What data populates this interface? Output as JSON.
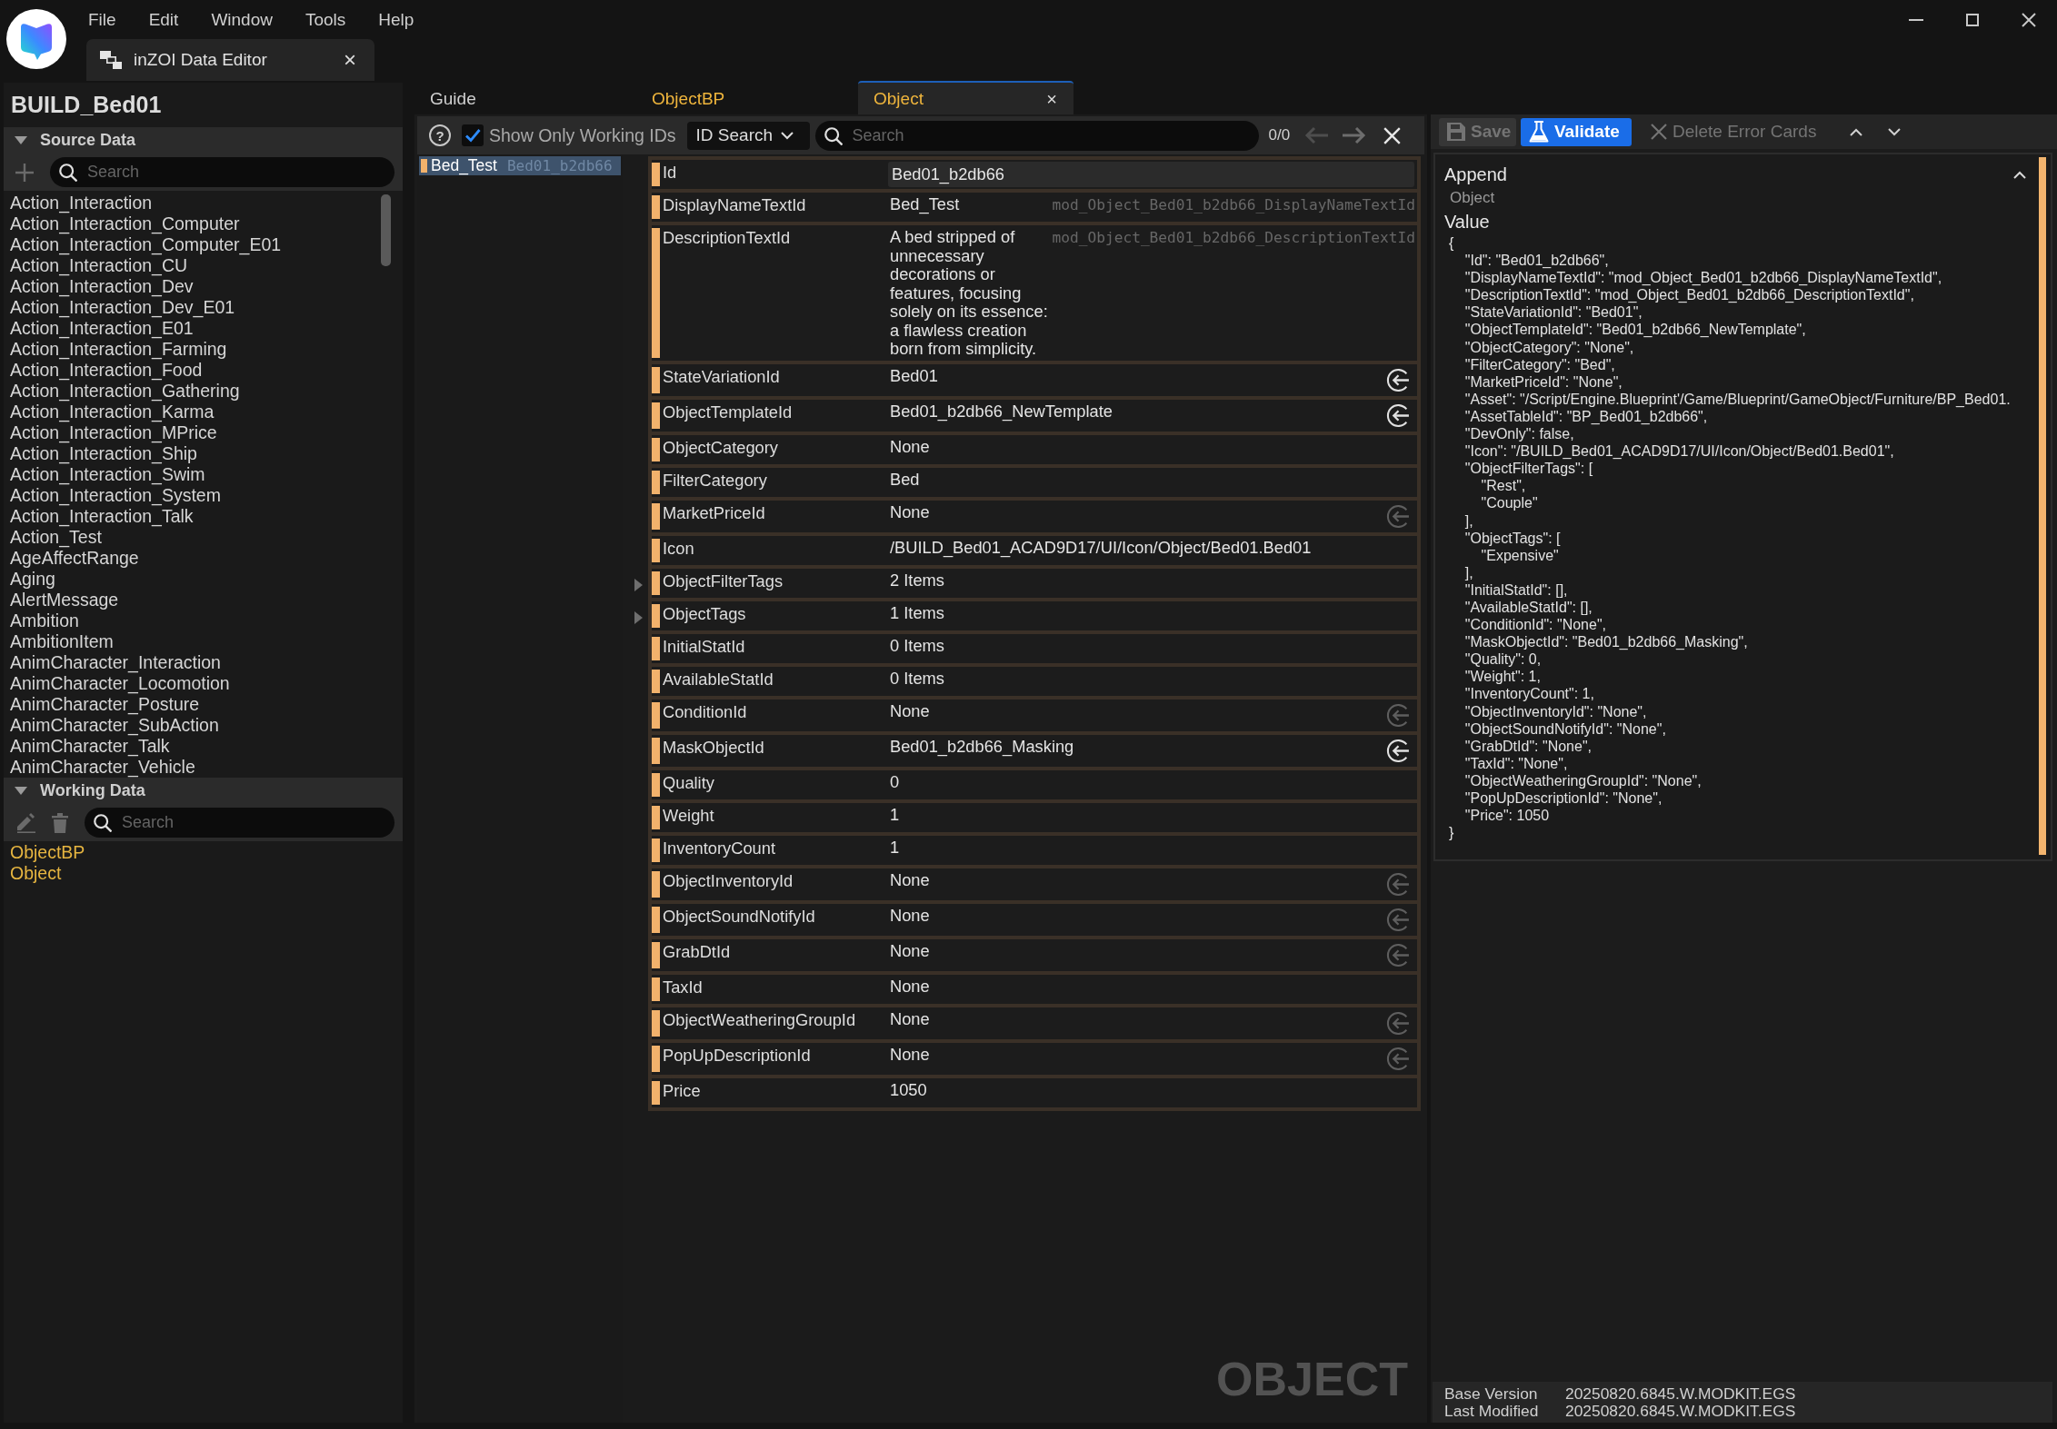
{
  "titlebar": {
    "menu": [
      "File",
      "Edit",
      "Window",
      "Tools",
      "Help"
    ],
    "tab": {
      "title": "inZOI Data Editor",
      "close": "×"
    }
  },
  "left_panel": {
    "title": "BUILD_Bed01",
    "sections": [
      {
        "kind": "source",
        "header": "Source Data",
        "expanded": true,
        "search": {
          "placeholder": "Search"
        },
        "items": [
          "Action_Interaction",
          "Action_Interaction_Computer",
          "Action_Interaction_Computer_E01",
          "Action_Interaction_CU",
          "Action_Interaction_Dev",
          "Action_Interaction_Dev_E01",
          "Action_Interaction_E01",
          "Action_Interaction_Farming",
          "Action_Interaction_Food",
          "Action_Interaction_Gathering",
          "Action_Interaction_Karma",
          "Action_Interaction_MPrice",
          "Action_Interaction_Ship",
          "Action_Interaction_Swim",
          "Action_Interaction_System",
          "Action_Interaction_Talk",
          "Action_Test",
          "AgeAffectRange",
          "Aging",
          "AlertMessage",
          "Ambition",
          "AmbitionItem",
          "AnimCharacter_Interaction",
          "AnimCharacter_Locomotion",
          "AnimCharacter_Posture",
          "AnimCharacter_SubAction",
          "AnimCharacter_Talk",
          "AnimCharacter_Vehicle"
        ]
      },
      {
        "kind": "working",
        "header": "Working Data",
        "expanded": true,
        "search": {
          "placeholder": "Search"
        },
        "items": [
          "ObjectBP",
          "Object"
        ]
      }
    ]
  },
  "editor": {
    "tabs": [
      {
        "label": "Guide",
        "selected": false,
        "modified": false
      },
      {
        "label": "ObjectBP",
        "selected": false,
        "modified": true
      },
      {
        "label": "Object",
        "selected": true,
        "modified": true,
        "close": "×"
      }
    ],
    "toolbar": {
      "help": "?",
      "working_only": {
        "label": "Show Only Working IDs",
        "checked": true
      },
      "search_mode": "ID Search",
      "search": {
        "placeholder": "Search"
      },
      "match_count": "0/0"
    },
    "ids": [
      {
        "name": "Bed_Test",
        "id": "Bed01_b2db66",
        "selected": true
      }
    ],
    "properties": [
      {
        "name": "Id",
        "kind": "field",
        "value": "Bed01_b2db66"
      },
      {
        "name": "DisplayNameTextId",
        "kind": "text",
        "value": "Bed_Test",
        "loc_key": "mod_Object_Bed01_b2db66_DisplayNameTextId"
      },
      {
        "name": "DescriptionTextId",
        "kind": "text",
        "value": "A bed stripped of unnecessary decorations or features, focusing solely on its essence: a flawless creation born from simplicity.",
        "loc_key": "mod_Object_Bed01_b2db66_DescriptionTextId"
      },
      {
        "name": "StateVariationId",
        "kind": "reference",
        "value": "Bed01",
        "link_disabled": false
      },
      {
        "name": "ObjectTemplateId",
        "kind": "reference",
        "value": "Bed01_b2db66_NewTemplate",
        "link_disabled": false
      },
      {
        "name": "ObjectCategory",
        "kind": "text",
        "value": "None"
      },
      {
        "name": "FilterCategory",
        "kind": "text",
        "value": "Bed"
      },
      {
        "name": "MarketPriceId",
        "kind": "reference",
        "value": "None",
        "link_disabled": true
      },
      {
        "name": "Icon",
        "kind": "text",
        "value": "/BUILD_Bed01_ACAD9D17/UI/Icon/Object/Bed01.Bed01"
      },
      {
        "name": "ObjectFilterTags",
        "kind": "array",
        "value": "2 Items",
        "expanded": false
      },
      {
        "name": "ObjectTags",
        "kind": "array",
        "value": "1 Items",
        "expanded": false
      },
      {
        "name": "InitialStatId",
        "kind": "text",
        "value": "0 Items"
      },
      {
        "name": "AvailableStatId",
        "kind": "text",
        "value": "0 Items"
      },
      {
        "name": "ConditionId",
        "kind": "reference",
        "value": "None",
        "link_disabled": true
      },
      {
        "name": "MaskObjectId",
        "kind": "reference",
        "value": "Bed01_b2db66_Masking",
        "link_disabled": false
      },
      {
        "name": "Quality",
        "kind": "text",
        "value": "0"
      },
      {
        "name": "Weight",
        "kind": "text",
        "value": "1"
      },
      {
        "name": "InventoryCount",
        "kind": "text",
        "value": "1"
      },
      {
        "name": "ObjectInventoryId",
        "kind": "reference",
        "value": "None",
        "link_disabled": true
      },
      {
        "name": "ObjectSoundNotifyId",
        "kind": "reference",
        "value": "None",
        "link_disabled": true
      },
      {
        "name": "GrabDtId",
        "kind": "reference",
        "value": "None",
        "link_disabled": true
      },
      {
        "name": "TaxId",
        "kind": "text",
        "value": "None"
      },
      {
        "name": "ObjectWeatheringGroupId",
        "kind": "reference",
        "value": "None",
        "link_disabled": true
      },
      {
        "name": "PopUpDescriptionId",
        "kind": "reference",
        "value": "None",
        "link_disabled": true
      },
      {
        "name": "Price",
        "kind": "text",
        "value": "1050"
      }
    ],
    "type_label": "OBJECT"
  },
  "inspector": {
    "toolbar": [
      {
        "kind": "save",
        "label": "Save",
        "disabled": true
      },
      {
        "kind": "validate",
        "label": "Validate",
        "disabled": false
      },
      {
        "kind": "delete",
        "label": "Delete Error Cards",
        "disabled": true
      },
      {
        "kind": "up"
      },
      {
        "kind": "down"
      }
    ],
    "cards": [
      {
        "title": "Append",
        "expanded": true,
        "subtitle": "Object",
        "value_label": "Value",
        "value": "{\n    \"Id\": \"Bed01_b2db66\",\n    \"DisplayNameTextId\": \"mod_Object_Bed01_b2db66_DisplayNameTextId\",\n    \"DescriptionTextId\": \"mod_Object_Bed01_b2db66_DescriptionTextId\",\n    \"StateVariationId\": \"Bed01\",\n    \"ObjectTemplateId\": \"Bed01_b2db66_NewTemplate\",\n    \"ObjectCategory\": \"None\",\n    \"FilterCategory\": \"Bed\",\n    \"MarketPriceId\": \"None\",\n    \"Asset\": \"/Script/Engine.Blueprint'/Game/Blueprint/GameObject/Furniture/BP_Bed01.\n    \"AssetTableId\": \"BP_Bed01_b2db66\",\n    \"DevOnly\": false,\n    \"Icon\": \"/BUILD_Bed01_ACAD9D17/UI/Icon/Object/Bed01.Bed01\",\n    \"ObjectFilterTags\": [\n        \"Rest\",\n        \"Couple\"\n    ],\n    \"ObjectTags\": [\n        \"Expensive\"\n    ],\n    \"InitialStatId\": [],\n    \"AvailableStatId\": [],\n    \"ConditionId\": \"None\",\n    \"MaskObjectId\": \"Bed01_b2db66_Masking\",\n    \"Quality\": 0,\n    \"Weight\": 1,\n    \"InventoryCount\": 1,\n    \"ObjectInventoryId\": \"None\",\n    \"ObjectSoundNotifyId\": \"None\",\n    \"GrabDtId\": \"None\",\n    \"TaxId\": \"None\",\n    \"ObjectWeatheringGroupId\": \"None\",\n    \"PopUpDescriptionId\": \"None\",\n    \"Price\": 1050\n}"
      }
    ],
    "footer": [
      {
        "label": "Base Version",
        "value": "20250820.6845.W.MODKIT.EGS"
      },
      {
        "label": "Last Modified",
        "value": "20250820.6845.W.MODKIT.EGS"
      }
    ]
  }
}
